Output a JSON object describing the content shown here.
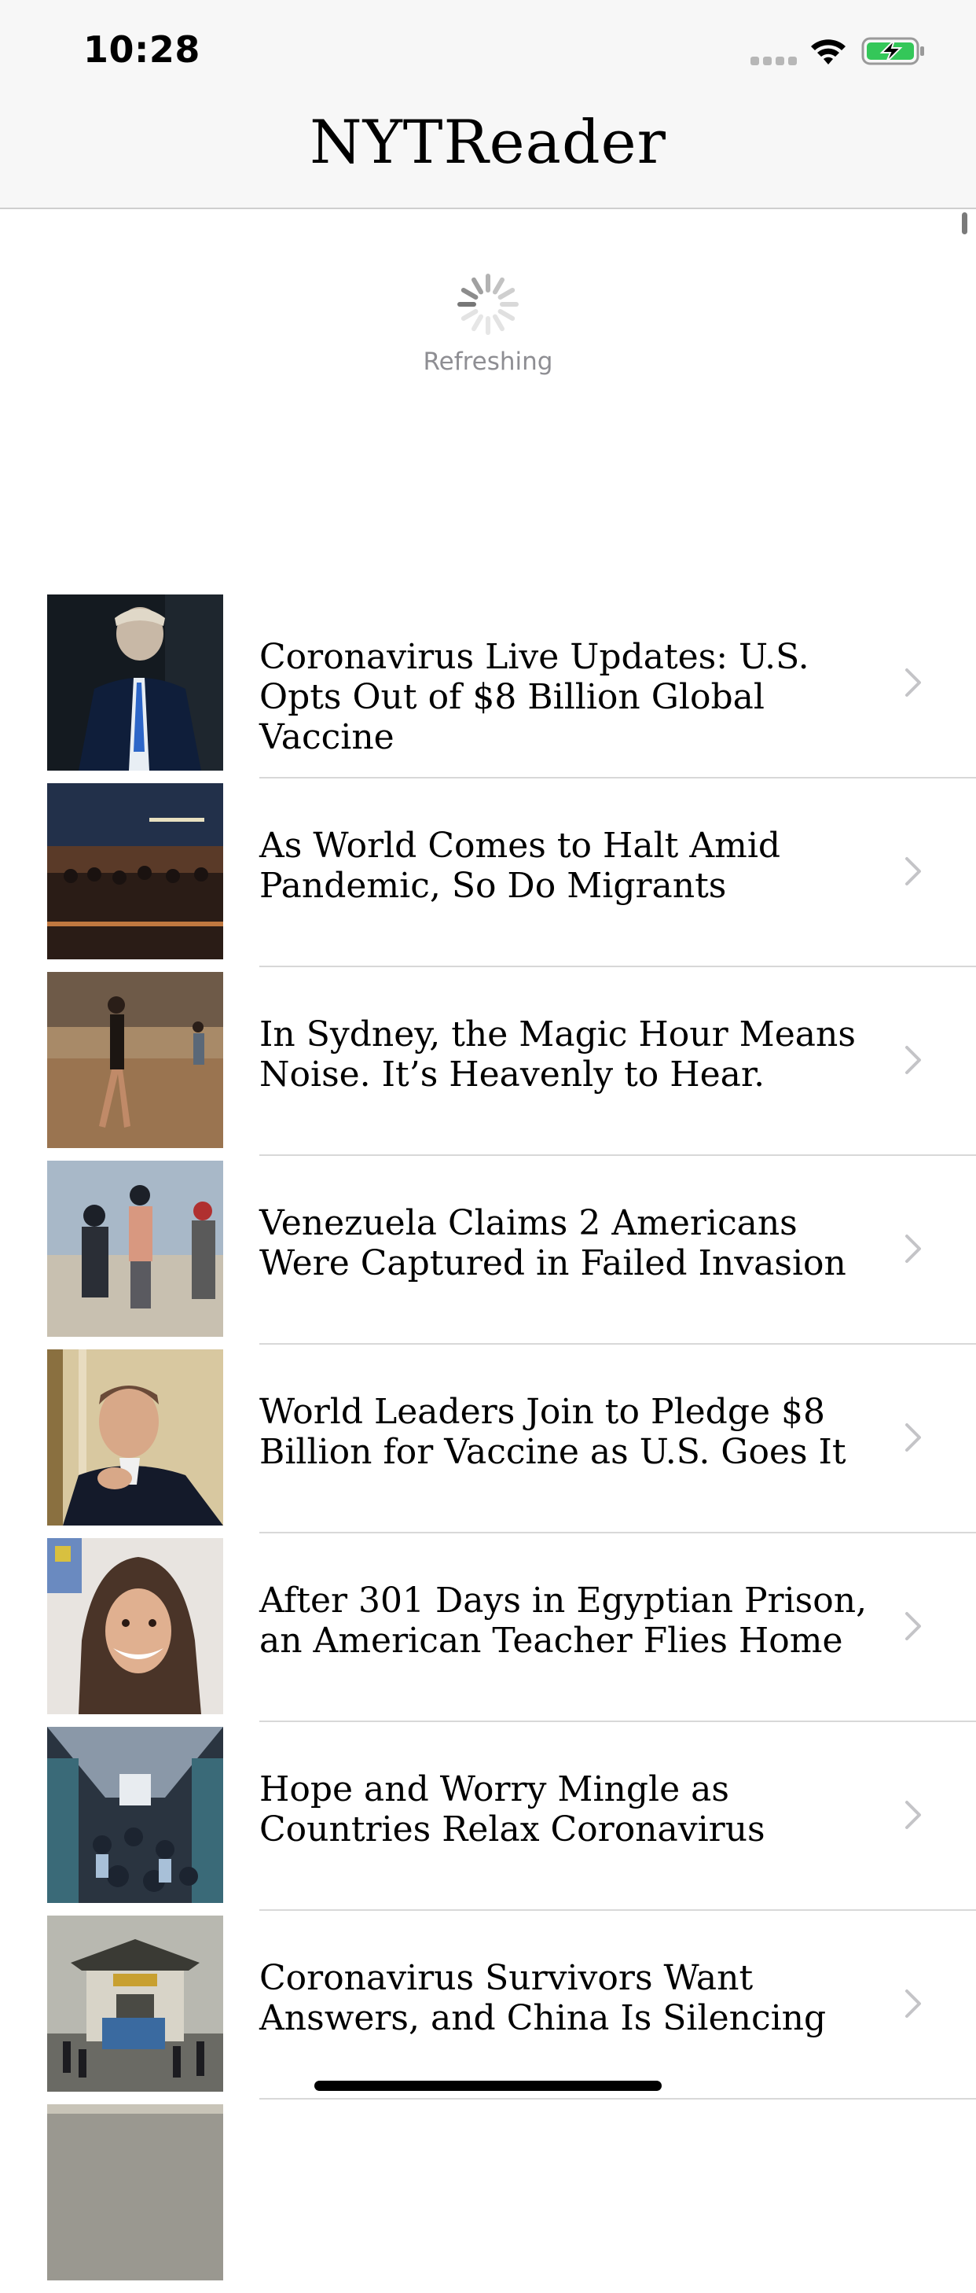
{
  "status_bar": {
    "time": "10:28",
    "icons": [
      "cellular-signal-icon",
      "wifi-icon",
      "battery-charging-icon"
    ]
  },
  "nav": {
    "title": "NYTReader"
  },
  "refresh": {
    "label": "Refreshing"
  },
  "articles": [
    {
      "headline": "Coronavirus Live Updates: U.S. Opts Out of $8 Billion Global Vaccine",
      "thumbnail": "photo-man-in-suit"
    },
    {
      "headline": "As World Comes to Halt Amid Pandemic, So Do Migrants",
      "thumbnail": "photo-migrants-at-dusk"
    },
    {
      "headline": "In Sydney, the Magic Hour Means Noise. It’s Heavenly to Hear.",
      "thumbnail": "photo-beach-sunset"
    },
    {
      "headline": "Venezuela Claims 2 Americans Were Captured in Failed Invasion",
      "thumbnail": "photo-soldiers-on-beach"
    },
    {
      "headline": "World Leaders Join to Pledge $8 Billion for Vaccine as U.S. Goes It",
      "thumbnail": "photo-leader-portrait"
    },
    {
      "headline": "After 301 Days in Egyptian Prison, an American Teacher Flies Home",
      "thumbnail": "photo-woman-in-headscarf"
    },
    {
      "headline": "Hope and Worry Mingle as Countries Relax Coronavirus",
      "thumbnail": "photo-commuters-in-station"
    },
    {
      "headline": "Coronavirus Survivors Want Answers, and China Is Silencing",
      "thumbnail": "photo-chinese-gate"
    }
  ],
  "colors": {
    "bar_background": "#f7f7f7",
    "separator": "#d8d8d8",
    "secondary_text": "#8e8e93",
    "chevron": "#c4c4c7",
    "battery_charge": "#34c759"
  }
}
